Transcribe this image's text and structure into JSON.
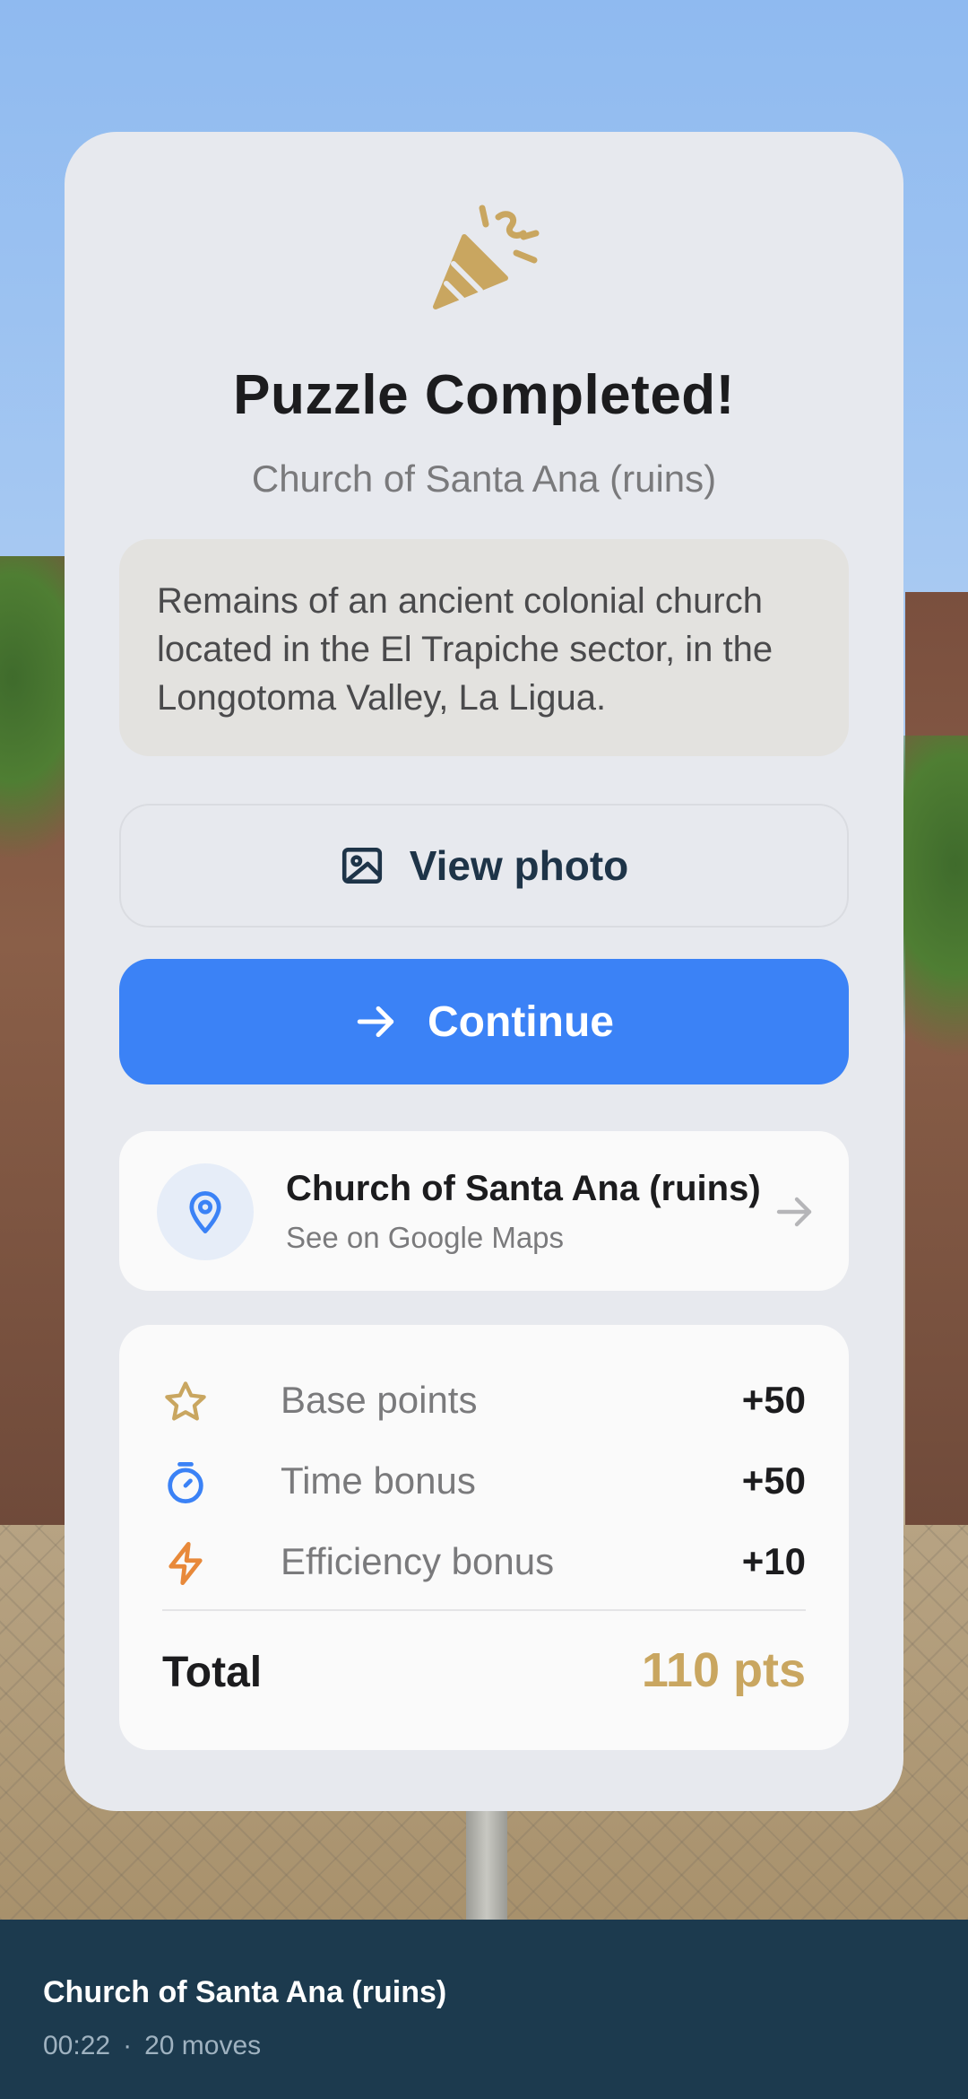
{
  "result": {
    "title": "Puzzle Completed!",
    "subtitle": "Church of Santa Ana (ruins)",
    "description": "Remains of an ancient colonial church located in the El Trapiche sector, in the Longotoma Valley, La Ligua."
  },
  "actions": {
    "view_photo_label": "View photo",
    "continue_label": "Continue"
  },
  "maps": {
    "place_name": "Church of Santa Ana (ruins)",
    "link_label": "See on Google Maps"
  },
  "points": {
    "rows": [
      {
        "label": "Base points",
        "value": "+50",
        "icon": "star-icon"
      },
      {
        "label": "Time bonus",
        "value": "+50",
        "icon": "stopwatch-icon"
      },
      {
        "label": "Efficiency bonus",
        "value": "+10",
        "icon": "lightning-icon"
      }
    ],
    "total_label": "Total",
    "total_value": "110 pts"
  },
  "footer": {
    "title": "Church of Santa Ana (ruins)",
    "time": "00:22",
    "separator": "·",
    "moves": "20 moves"
  },
  "colors": {
    "accent_blue": "#3b82f6",
    "gold": "#c9a660",
    "footer_bg": "#1c3a4e"
  }
}
